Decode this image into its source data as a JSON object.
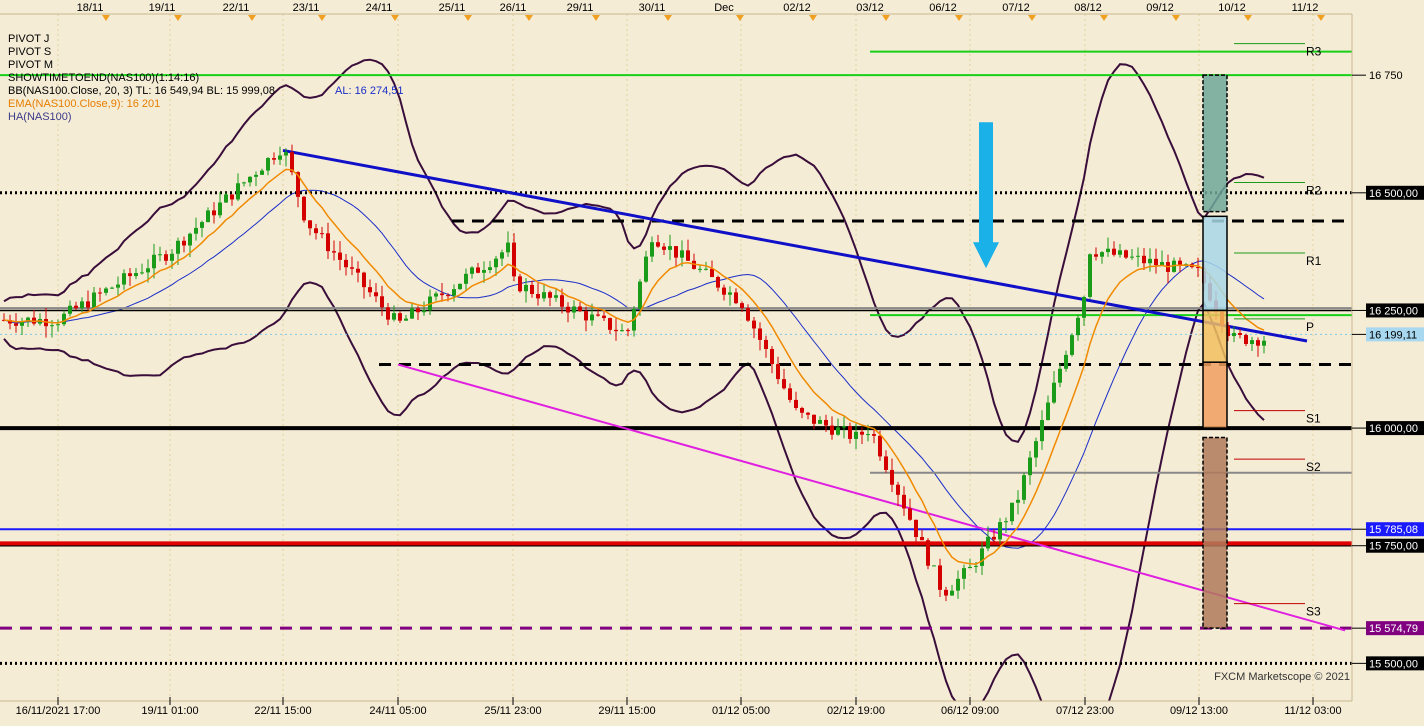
{
  "top_dates": [
    "18/11",
    "19/11",
    "22/11",
    "23/11",
    "24/11",
    "25/11",
    "26/11",
    "29/11",
    "30/11",
    "Dec",
    "02/12",
    "03/12",
    "06/12",
    "07/12",
    "08/12",
    "09/12",
    "10/12",
    "11/12"
  ],
  "bottom_times": [
    "16/11/2021 17:00",
    "19/11 01:00",
    "22/11 15:00",
    "24/11 05:00",
    "25/11 23:00",
    "29/11 15:00",
    "01/12 05:00",
    "02/12 19:00",
    "06/12 09:00",
    "07/12 23:00",
    "09/12 13:00",
    "11/12 03:00"
  ],
  "indicators": [
    {
      "text": "PIVOT J",
      "color": "#000000"
    },
    {
      "text": "PIVOT S",
      "color": "#000000"
    },
    {
      "text": "PIVOT M",
      "color": "#000000"
    },
    {
      "text": "SHOWTIMETOEND(NAS100)(1:14:16)",
      "color": "#000000"
    },
    {
      "text": "BB(NAS100.Close, 20, 3)  TL: 16 549,94  BL: 15 999,08",
      "color": "#000000",
      "extra": "AL: 16 274,51",
      "extra_color": "#1a2ec8"
    },
    {
      "text": "EMA(NAS100.Close,9): 16 201",
      "color": "#e67e00"
    },
    {
      "text": "HA(NAS100)",
      "color": "#3b3b8a"
    }
  ],
  "price_labels": [
    {
      "text": "16 750",
      "value": 16750,
      "bg": "#f5ecd6",
      "fg": "#000000"
    },
    {
      "text": "16 500,00",
      "value": 16500,
      "bg": "#000000",
      "fg": "#ffffff"
    },
    {
      "text": "16 250,00",
      "value": 16250,
      "bg": "#000000",
      "fg": "#ffffff"
    },
    {
      "text": "16 199,11",
      "value": 16199.11,
      "bg": "#a8d8f0",
      "fg": "#000000"
    },
    {
      "text": "16 000,00",
      "value": 16000,
      "bg": "#000000",
      "fg": "#ffffff"
    },
    {
      "text": "15 785,08",
      "value": 15785.08,
      "bg": "#1a1aff",
      "fg": "#ffffff"
    },
    {
      "text": "15 750,00",
      "value": 15750,
      "bg": "#000000",
      "fg": "#ffffff"
    },
    {
      "text": "15 574,79",
      "value": 15574.79,
      "bg": "#800080",
      "fg": "#ffffff"
    },
    {
      "text": "15 500,00",
      "value": 15500,
      "bg": "#000000",
      "fg": "#ffffff"
    }
  ],
  "pivot_labels": [
    {
      "text": "R3",
      "value": 16800
    },
    {
      "text": "R2",
      "value": 16505
    },
    {
      "text": "R1",
      "value": 16355
    },
    {
      "text": "P",
      "value": 16215
    },
    {
      "text": "S1",
      "value": 16020
    },
    {
      "text": "S2",
      "value": 15917
    },
    {
      "text": "S3",
      "value": 15610
    }
  ],
  "watermark": "FXCM Marketscope © 2021",
  "colors": {
    "background": "#f5ecd6",
    "up": "#1a9c1a",
    "down": "#d40000",
    "ema": "#f08a00",
    "bb_band": "#3a0e3a",
    "bb_mid": "#1a2ec8",
    "trend_blue": "#1010c8",
    "trend_magenta": "#e020e0",
    "green_level": "#18d018",
    "red_level": "#e00000"
  },
  "chart_data": {
    "type": "candlestick",
    "symbol": "NAS100",
    "ylim": [
      15420,
      16880
    ],
    "x_range": [
      "16/11/2021 17:00",
      "11/12 03:00"
    ],
    "horizontal_levels": [
      {
        "value": 16800,
        "style": "solid",
        "color": "#18d018",
        "from": "03/12",
        "to": "11/12"
      },
      {
        "value": 16750,
        "style": "solid",
        "color": "#18d018",
        "from": "01/12",
        "to": "11/12"
      },
      {
        "value": 16500,
        "style": "dotted",
        "color": "#000000"
      },
      {
        "value": 16440,
        "style": "dashed",
        "color": "#000000",
        "from": "25/11",
        "to": "11/12"
      },
      {
        "value": 16255,
        "style": "solid",
        "color": "#888888",
        "from": "01/12",
        "to": "11/12"
      },
      {
        "value": 16250,
        "style": "solid",
        "color": "#000000"
      },
      {
        "value": 16240,
        "style": "solid",
        "color": "#18d018",
        "from": "03/12",
        "to": "11/12"
      },
      {
        "value": 16199.11,
        "style": "dotted",
        "color": "#7fc8e8"
      },
      {
        "value": 16135,
        "style": "dashed",
        "color": "#000000",
        "from": "24/11",
        "to": "11/12"
      },
      {
        "value": 16000,
        "style": "solid",
        "color": "#000000",
        "width": "thick"
      },
      {
        "value": 15905,
        "style": "solid",
        "color": "#888888",
        "from": "03/12",
        "to": "11/12"
      },
      {
        "value": 15785.08,
        "style": "solid",
        "color": "#1a1aff"
      },
      {
        "value": 15750,
        "style": "solid",
        "color": "#000000"
      },
      {
        "value": 15755,
        "style": "solid",
        "color": "#e00000",
        "width": "thick",
        "from": "01/12",
        "to": "11/12"
      },
      {
        "value": 15574.79,
        "style": "dashed",
        "color": "#800080"
      },
      {
        "value": 15500,
        "style": "dotted",
        "color": "#000000"
      }
    ],
    "trendlines": [
      {
        "color": "#1010c8",
        "from": [
          "22/11 15:00",
          16590
        ],
        "to": [
          "10/12",
          16185
        ]
      },
      {
        "color": "#e020e0",
        "from": [
          "24/11 05:00",
          16135
        ],
        "to": [
          "11/12",
          15570
        ]
      }
    ],
    "close_series": [
      {
        "t": "16/11/2021 17:00",
        "close": 16230
      },
      {
        "t": "19/11 01:00",
        "close": 16375
      },
      {
        "t": "22/11 15:00",
        "close": 16600
      },
      {
        "t": "23/11",
        "close": 16440
      },
      {
        "t": "24/11 05:00",
        "close": 16220
      },
      {
        "t": "25/11 23:00",
        "close": 16390
      },
      {
        "t": "26/11",
        "close": 16310
      },
      {
        "t": "29/11 15:00",
        "close": 16200
      },
      {
        "t": "30/11",
        "close": 16410
      },
      {
        "t": "01/12 05:00",
        "close": 16270
      },
      {
        "t": "02/12",
        "close": 16030
      },
      {
        "t": "02/12 19:00",
        "close": 15980
      },
      {
        "t": "03/12",
        "close": 16000
      },
      {
        "t": "06/12",
        "close": 15650
      },
      {
        "t": "06/12 09:00",
        "close": 15700
      },
      {
        "t": "07/12",
        "close": 15840
      },
      {
        "t": "07/12 23:00",
        "close": 16290
      },
      {
        "t": "08/12",
        "close": 16380
      },
      {
        "t": "09/12 13:00",
        "close": 16330
      },
      {
        "t": "10/12",
        "close": 16190
      }
    ]
  }
}
